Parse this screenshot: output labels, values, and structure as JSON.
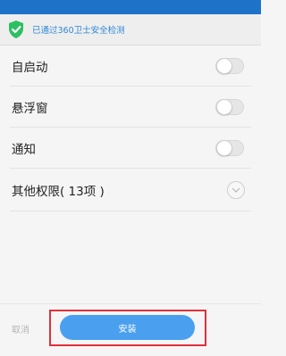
{
  "security": {
    "text": "已通过360卫士安全检测",
    "icon": "shield-check-icon",
    "icon_color": "#2dbf63"
  },
  "permissions": [
    {
      "label": "自启动",
      "control": "toggle",
      "enabled": false
    },
    {
      "label": "悬浮窗",
      "control": "toggle",
      "enabled": false
    },
    {
      "label": "通知",
      "control": "toggle",
      "enabled": false
    },
    {
      "label": "其他权限( 13项 )",
      "control": "expand",
      "icon": "chevron-down-icon"
    }
  ],
  "footer": {
    "cancel_label": "取消",
    "install_label": "安装",
    "install_color": "#4aa0ef",
    "highlight_color": "#e0303a"
  },
  "colors": {
    "top_bar": "#1e73c8",
    "security_text": "#2e88d6"
  }
}
